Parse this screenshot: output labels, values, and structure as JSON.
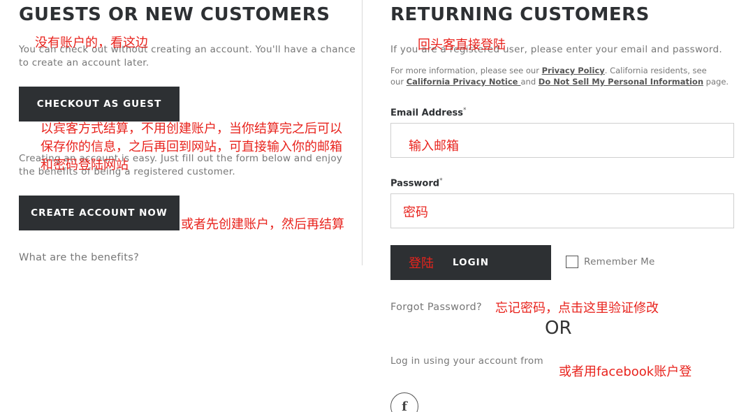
{
  "guest": {
    "heading": "GUESTS OR NEW CUSTOMERS",
    "checkout_text_1": "You can check out without creating an account. You'll have a chance",
    "checkout_text_2": "to create an account later.",
    "checkout_button": "CHECKOUT AS GUEST",
    "create_text_1": "Creating an account is easy. Just fill out the form below and enjoy",
    "create_text_2": "the benefits of being a registered customer.",
    "create_button": "CREATE ACCOUNT NOW",
    "benefits_link": "What are the benefits?"
  },
  "returning": {
    "heading": "RETURNING CUSTOMERS",
    "intro": "If you are a registered user, please enter your email and password.",
    "info_prefix": "For more information, please see our ",
    "privacy_policy": "Privacy Policy",
    "info_mid": ". California residents, see",
    "info_our": "our ",
    "california_notice": "California Privacy Notice ",
    "info_and": "and ",
    "do_not_sell": "Do Not Sell My Personal Information",
    "info_suffix": " page.",
    "email_label": "Email Address",
    "password_label": "Password",
    "required_mark": "*",
    "login_button": "LOGIN",
    "remember_me": "Remember Me",
    "forgot_password": "Forgot Password?",
    "or": "OR",
    "social_text": "Log in using your account from",
    "facebook_glyph": "f"
  },
  "annotations": {
    "no_account": "没有账户的，看这边",
    "returning": "回头客直接登陆",
    "guest_line_1": "以宾客方式结算，不用创建账户，当你结算完之后可以",
    "guest_line_2": "保存你的信息，之后再回到网站，可直接输入你的邮箱",
    "guest_line_3": "和密码登陆网站",
    "create_first": "或者先创建账户，然后再结算",
    "enter_email": "输入邮箱",
    "password": "密码",
    "login": "登陆",
    "forgot": "忘记密码，点击这里验证修改",
    "facebook": "或者用facebook账户登"
  },
  "colors": {
    "button_dark": "#2d3033",
    "annotation_red": "#e8231d"
  }
}
